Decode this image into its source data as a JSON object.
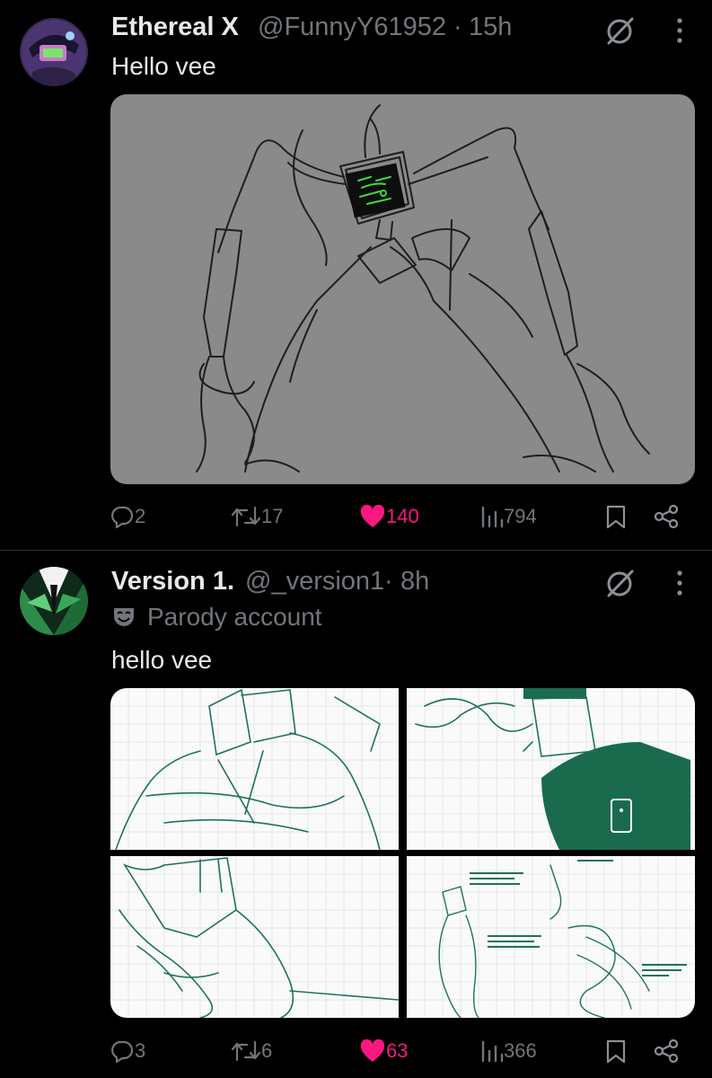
{
  "tweets": [
    {
      "name": "Ethereal X",
      "handle": "@FunnyY61952",
      "time": "15h",
      "text": "Hello vee",
      "stats": {
        "replies": "2",
        "reposts": "17",
        "likes": "140",
        "views": "794"
      }
    },
    {
      "name": "Version 1.",
      "handle": "@_version1",
      "time": "8h",
      "badge": "Parody account",
      "text": "hello vee",
      "stats": {
        "replies": "3",
        "reposts": "6",
        "likes": "63",
        "views": "366"
      }
    }
  ],
  "colors": {
    "like": "#f91880",
    "muted": "#71767b",
    "text": "#e7e9ea",
    "sketch_green": "#1a6b4e"
  },
  "icons": [
    "reply-icon",
    "repost-icon",
    "heart-icon",
    "views-icon",
    "bookmark-icon",
    "share-icon",
    "grok-icon",
    "more-icon",
    "parody-mask-icon"
  ]
}
